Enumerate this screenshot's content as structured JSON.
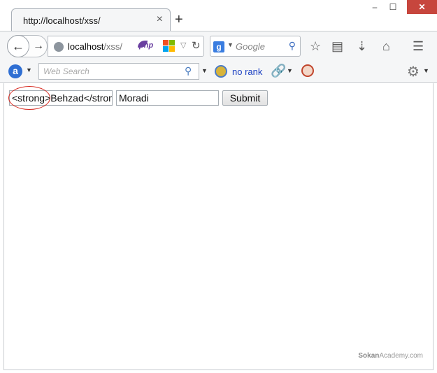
{
  "window": {
    "tab_title": "http://localhost/xss/",
    "tab_close": "×",
    "new_tab": "+",
    "minimize": "–",
    "maximize": "☐",
    "close": "✕"
  },
  "navbar": {
    "url_host": "localhost",
    "url_path": "/xss/",
    "php_badge": "php",
    "search_engine_icon": "g",
    "search_placeholder": "Google"
  },
  "addonbar": {
    "websearch_placeholder": "Web Search",
    "rank_text": "no rank"
  },
  "form": {
    "first_name_value": "<strong>Behzad</strong>",
    "last_name_value": "Moradi",
    "submit_label": "Submit"
  },
  "watermark": {
    "brand": "Sokan",
    "suffix": "Academy.com"
  },
  "colors": {
    "close_button": "#c7463d",
    "highlight_ellipse": "#d6281f",
    "link_blue": "#1a3fc2"
  }
}
